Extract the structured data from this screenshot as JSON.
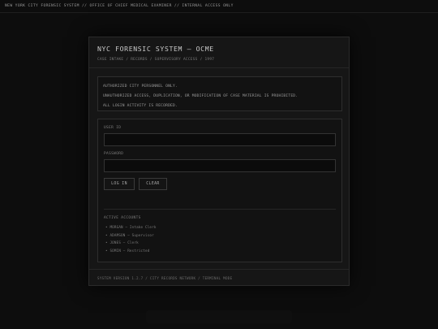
{
  "topbar": {
    "text": "NEW YORK CITY FORENSIC SYSTEM // OFFICE OF CHIEF MEDICAL EXAMINER // INTERNAL ACCESS ONLY"
  },
  "panel": {
    "title": "NYC FORENSIC SYSTEM — OCME",
    "subtitle": "CASE INTAKE / RECORDS / SUPERVISORY ACCESS / 1997"
  },
  "notice": {
    "lines": [
      "AUTHORIZED CITY PERSONNEL ONLY.",
      "UNAUTHORIZED ACCESS, DUPLICATION, OR MODIFICATION OF CASE MATERIAL IS PROHIBITED.",
      "ALL LOGIN ACTIVITY IS RECORDED."
    ]
  },
  "login": {
    "user_label": "USER ID",
    "user_value": "",
    "password_label": "PASSWORD",
    "password_value": "",
    "login_button": "LOG IN",
    "clear_button": "CLEAR"
  },
  "accounts": {
    "title": "ACTIVE ACCOUNTS",
    "items": [
      "• MORGAN — Intake Clerk",
      "• ADAMSON — Supervisor",
      "• JONES — Clerk",
      "• SOMIN — Restricted"
    ]
  },
  "footer": {
    "text": "SYSTEM VERSION 1.2.7 / CITY RECORDS NETWORK / TERMINAL MODE"
  },
  "colors": {
    "background": "#0d0d0d",
    "panel": "#161616",
    "text": "#8e8e8e"
  }
}
